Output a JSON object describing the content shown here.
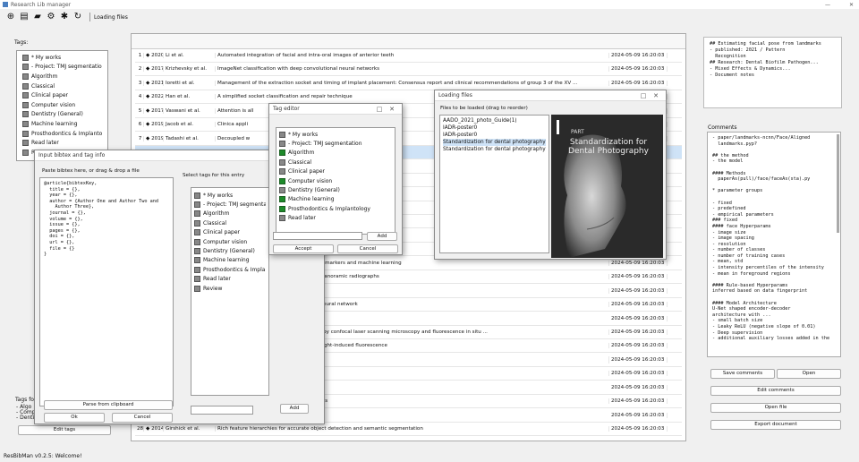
{
  "app": {
    "title": "Research Lib manager",
    "status": "ResBibMan v0.2.5: Welcome!",
    "toolbar_status": "Loading files"
  },
  "toolbar": {
    "icons": [
      "add-icon",
      "clipboard-icon",
      "folder-icon",
      "gear-icon",
      "settings-alt-icon",
      "refresh-icon"
    ]
  },
  "left": {
    "tags_heading": "Tags:",
    "tags": [
      "* My works",
      "- Project: TMJ segmentation",
      "Algorithm",
      "Classical",
      "Clinical paper",
      "Computer vision",
      "Dentistry (General)",
      "Machine learning",
      "Prosthodontics & Implantolo",
      "Read later",
      "R"
    ],
    "tags_for_heading": "Tags for",
    "tags_for_lines": [
      "- Algo",
      "- Comp",
      "- Dentis"
    ],
    "edit_button": "Edit tags"
  },
  "table": {
    "rows": [
      {
        "n": "1",
        "y": "2020",
        "a": "Li et al.",
        "t": "Automated integration of facial and intra-oral images of anterior teeth",
        "d": "2024-05-09 16:20:03"
      },
      {
        "n": "2",
        "y": "2017",
        "a": "Krizhevsky et al.",
        "t": "ImageNet classification with deep convolutional neural networks",
        "d": "2024-05-09 16:20:03"
      },
      {
        "n": "3",
        "y": "2021",
        "a": "Ioretti et al.",
        "t": "Management of the extraction socket and timing of implant placement: Consensus report and clinical recommendations of group 3 of the XV ...",
        "d": "2024-05-09 16:20:03"
      },
      {
        "n": "4",
        "y": "2022",
        "a": "Han et al.",
        "t": "A simplified socket classification and repair technique",
        "d": "2024-05-09 16:20:03"
      },
      {
        "n": "5",
        "y": "2017",
        "a": "Vaswani et al.",
        "t": "Attention is all",
        "d": "2024-05-09 16:20:03"
      },
      {
        "n": "6",
        "y": "2019",
        "a": "Jacob et al.",
        "t": "Clinica appli",
        "d": "2024-05-09 16:20:03"
      },
      {
        "n": "7",
        "y": "2019",
        "a": "Tadashi et al.",
        "t": "Decoupled w",
        "d": "2024-05-09 16:20:03"
      },
      {
        "n": "8",
        "y": "",
        "a": "",
        "t": "",
        "d": ""
      },
      {
        "n": "9",
        "y": "",
        "a": "",
        "t": "",
        "d": ""
      },
      {
        "n": "10",
        "y": "",
        "a": "",
        "t": "",
        "d": ""
      },
      {
        "n": "11",
        "y": "",
        "a": "",
        "t": "",
        "d": ""
      },
      {
        "n": "12",
        "y": "",
        "a": "",
        "t": "",
        "d": ""
      },
      {
        "n": "13",
        "y": "",
        "a": "",
        "t": "",
        "d": ""
      },
      {
        "n": "14",
        "y": "",
        "a": "",
        "t": "",
        "d": ""
      },
      {
        "n": "15",
        "y": "",
        "a": "",
        "t": "",
        "d": ""
      },
      {
        "n": "16",
        "y": "",
        "a": "",
        "t": "b lesion can be diagnosed earlier using biomarkers and machine learning",
        "d": "2024-05-09 16:20:03"
      },
      {
        "n": "17",
        "y": "",
        "a": "",
        "t": "for tooth detection and segmentation on panoramic radiographs",
        "d": "2024-05-09 16:20:03"
      },
      {
        "n": "18",
        "y": "",
        "a": "",
        "t": "ora healthcare",
        "d": "2024-05-09 16:20:03"
      },
      {
        "n": "19",
        "y": "",
        "a": "",
        "t": "ryngeal airway space with convolutional neural network",
        "d": "2024-05-09 16:20:03"
      },
      {
        "n": "20",
        "y": "",
        "a": "",
        "t": "",
        "d": "2024-05-09 16:20:03"
      },
      {
        "n": "21",
        "y": "",
        "a": "",
        "t": "and other bacteria in initial dental biofilm by confocal laser scanning microscopy and fluorescence in situ ...",
        "d": "2024-05-09 16:20:03"
      },
      {
        "n": "22",
        "y": "",
        "a": "",
        "t": "otential pathogenicity using quantitative light-induced fluorescence",
        "d": "2024-05-09 16:20:03"
      },
      {
        "n": "23",
        "y": "",
        "a": "",
        "t": "顎機能評価のためのソフトウエア",
        "d": "2024-05-09 16:20:03"
      },
      {
        "n": "24",
        "y": "",
        "a": "",
        "t": "e-of-the-art superpixel methods",
        "d": "2024-05-09 16:20:03"
      },
      {
        "n": "25",
        "y": "",
        "a": "",
        "t": "",
        "d": "2024-05-09 16:20:03"
      },
      {
        "n": "26",
        "y": "",
        "a": "",
        "t": "ect detection with region proposal networks",
        "d": "2024-05-09 16:20:03"
      },
      {
        "n": "27",
        "y": "",
        "a": "",
        "t": "",
        "d": "2024-05-09 16:20:03"
      },
      {
        "n": "28",
        "y": "2014",
        "a": "Girshick et al.",
        "t": "Rich feature hierarchies for accurate object detection and semantic segmentation",
        "d": "2024-05-09 16:20:03"
      }
    ]
  },
  "right": {
    "summary": "## Estimating facial pose from landmarks\n- published: 2021 / Pattern\n  Recognition\n## Research: Dental Biofilm Pathogen...\n- Mixed Effects & Dynamics...\n- Document notes",
    "comments_label": "Comments",
    "comments": "- paper/landmarks-ncnn/Face/Aligned\n  landmarks.pyp?\n\n## the method\n- the model\n\n#### Methods\n  paperAs(pull)/face/faceAs(sta).py\n\n* parameter groups\n\n- fixed\n- predefined\n- empirical parameters\n### fixed\n#### face Hyperparams\n- image size\n- image spacing\n- resolution\n- number of classes\n- number of training cases\n- mean, std\n- intensity percentiles of the intensity\n- mean in foreground regions\n\n#### Rule-based Hyperparams\ninferred based on data fingerprint\n\n#### Model Architecture\nU-Net shaped encoder-decoder\narchitecture with ...\n- small batch size\n- Leaky ReLU (negative slope of 0.01)\n- Deep supervision\n- additional auxiliary losses added in the",
    "buttons": [
      "Save comments",
      "Open",
      "Edit comments",
      "Open file",
      "Export document"
    ]
  },
  "tag_editor": {
    "title": "Tag editor",
    "tags": [
      "* My works",
      "- Project: TMJ segmentation",
      "Algorithm",
      "Classical",
      "Clinical paper",
      "Computer vision",
      "Dentistry (General)",
      "Machine learning",
      "Prosthodontics & Implantology",
      "Read later"
    ],
    "checked": [
      2,
      5,
      7,
      8
    ],
    "input_btn": "Add",
    "accept": "Accept",
    "cancel": "Cancel"
  },
  "bibtex": {
    "title": "Input bibtex and tag info",
    "header": "Paste bibtex here, or drag & drop a file",
    "tags_header": "Select tags for this entry",
    "text": "@article{bibtexKey,\n  title = {},\n  year = {},\n  author = {Author One and Author Two and\n    Author Three},\n  journal = {},\n  volume = {},\n  issue = {},\n  pages = {},\n  doi = {},\n  url = {},\n  file = {}\n}",
    "tags": [
      "* My works",
      "- Project: TMJ segmentation",
      "Algorithm",
      "Classical",
      "Clinical paper",
      "Computer vision",
      "Dentistry (General)",
      "Machine learning",
      "Prosthodontics & Implantology",
      "Read later",
      "Review"
    ],
    "parse": "Parse from clipboard",
    "ok": "Ok",
    "cancel": "Cancel",
    "add": "Add"
  },
  "files": {
    "title": "Loading files",
    "label": "Files to be loaded (drag to reorder)",
    "items": [
      "AADO_2021_photo_Guide(1)",
      "IADR-poster0",
      "IADR-poster0",
      "Standardization for dental photography!",
      "Standardization for dental photography2"
    ],
    "preview_part": "PART",
    "preview_title": "Standardization for Dental Photography"
  }
}
